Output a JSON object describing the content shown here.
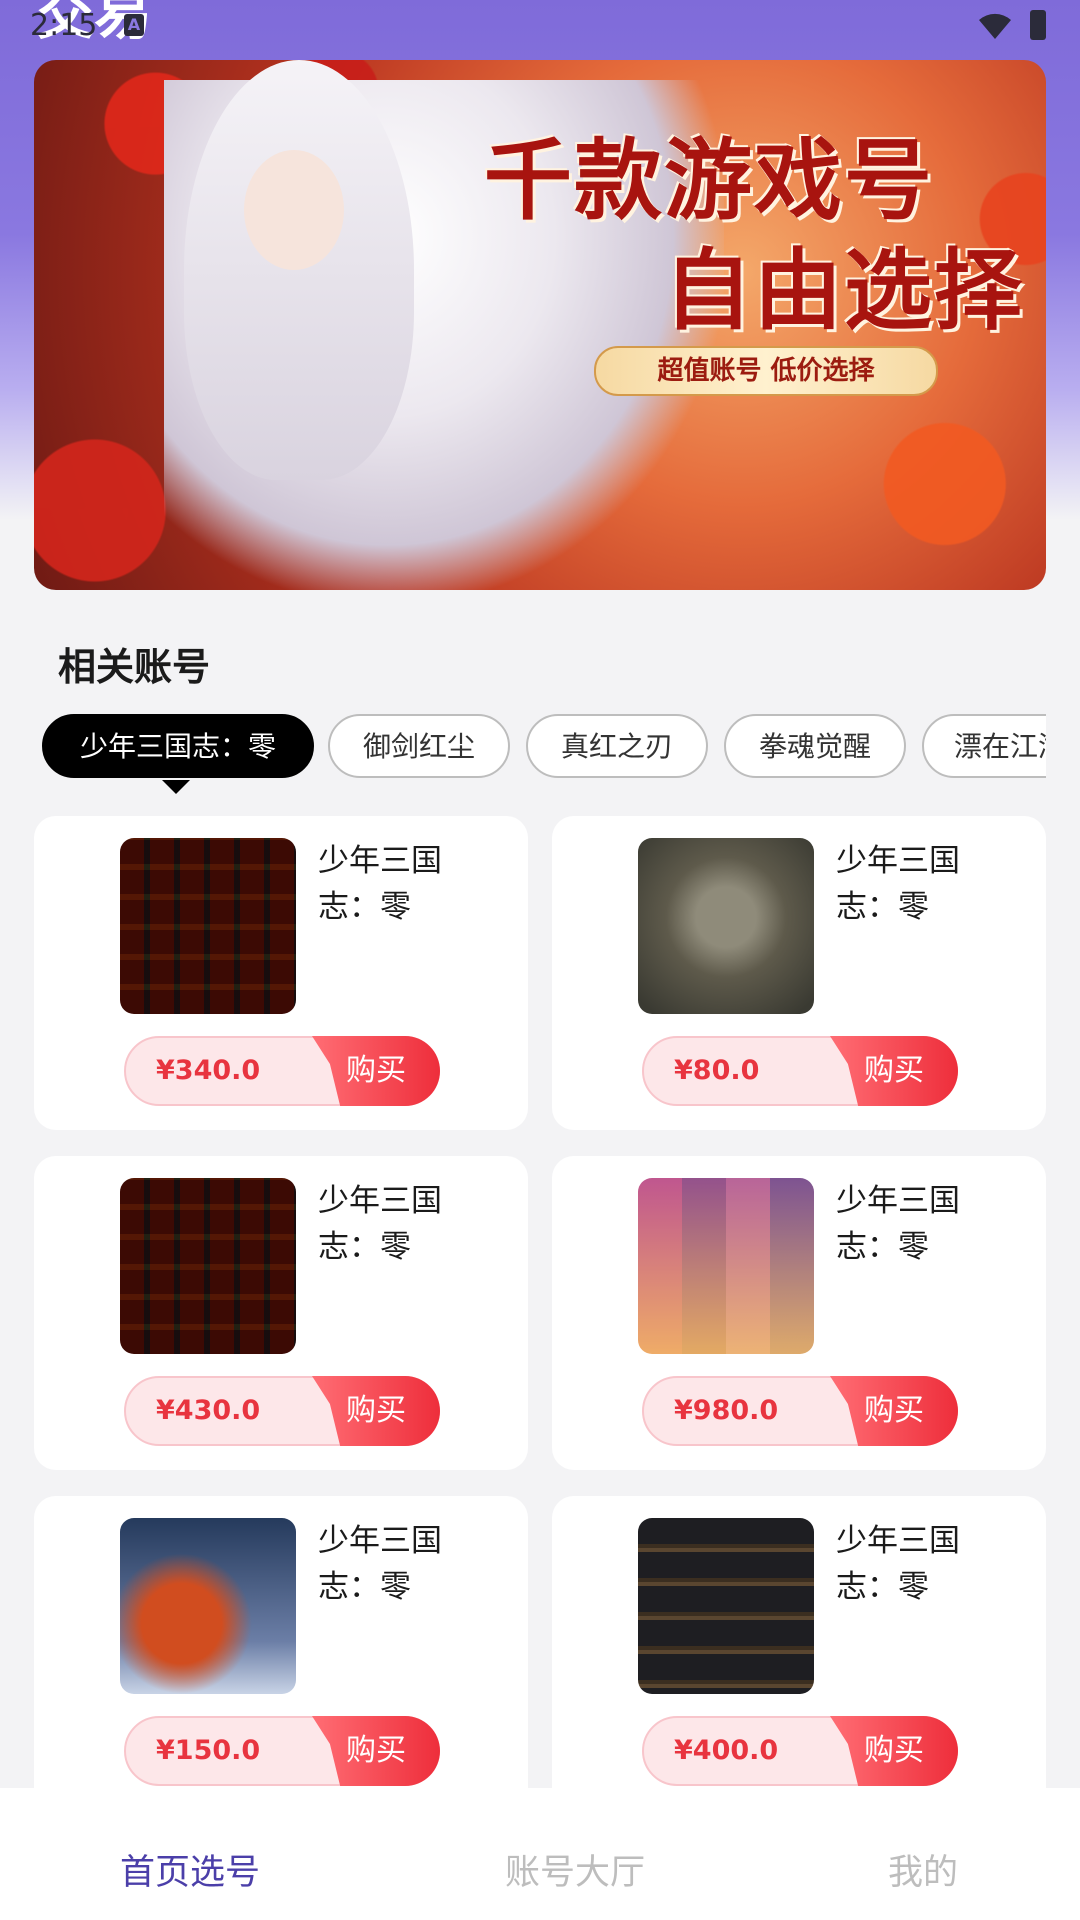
{
  "status_bar": {
    "time": "2:15",
    "a_badge": "A"
  },
  "header": {
    "title": "交易"
  },
  "banner": {
    "headline1": "千款游戏号",
    "headline2": "自由选择",
    "tagline": "超值账号 低价选择"
  },
  "section": {
    "title": "相关账号"
  },
  "chips": [
    {
      "label": "少年三国志：零",
      "active": true
    },
    {
      "label": "御剑红尘",
      "active": false
    },
    {
      "label": "真红之刃",
      "active": false
    },
    {
      "label": "拳魂觉醒",
      "active": false
    },
    {
      "label": "漂在江湖",
      "active": false
    }
  ],
  "products": [
    {
      "title": "少年三国志：零",
      "price": "¥340.0",
      "buy": "购买",
      "image": "inventory-grid"
    },
    {
      "title": "少年三国志：零",
      "price": "¥80.0",
      "buy": "购买",
      "image": "battle-defeat"
    },
    {
      "title": "少年三国志：零",
      "price": "¥430.0",
      "buy": "购买",
      "image": "inventory-grid"
    },
    {
      "title": "少年三国志：零",
      "price": "¥980.0",
      "buy": "购买",
      "image": "hero-cards"
    },
    {
      "title": "少年三国志：零",
      "price": "¥150.0",
      "buy": "购买",
      "image": "night-battle"
    },
    {
      "title": "少年三国志：零",
      "price": "¥400.0",
      "buy": "购买",
      "image": "ranking-list"
    }
  ],
  "bottom_nav": [
    {
      "label": "首页选号",
      "active": true
    },
    {
      "label": "账号大厅",
      "active": false
    },
    {
      "label": "我的",
      "active": false
    }
  ],
  "colors": {
    "header": "#8a78e0",
    "price": "#e8343f",
    "nav_active": "#4b3fa9"
  }
}
